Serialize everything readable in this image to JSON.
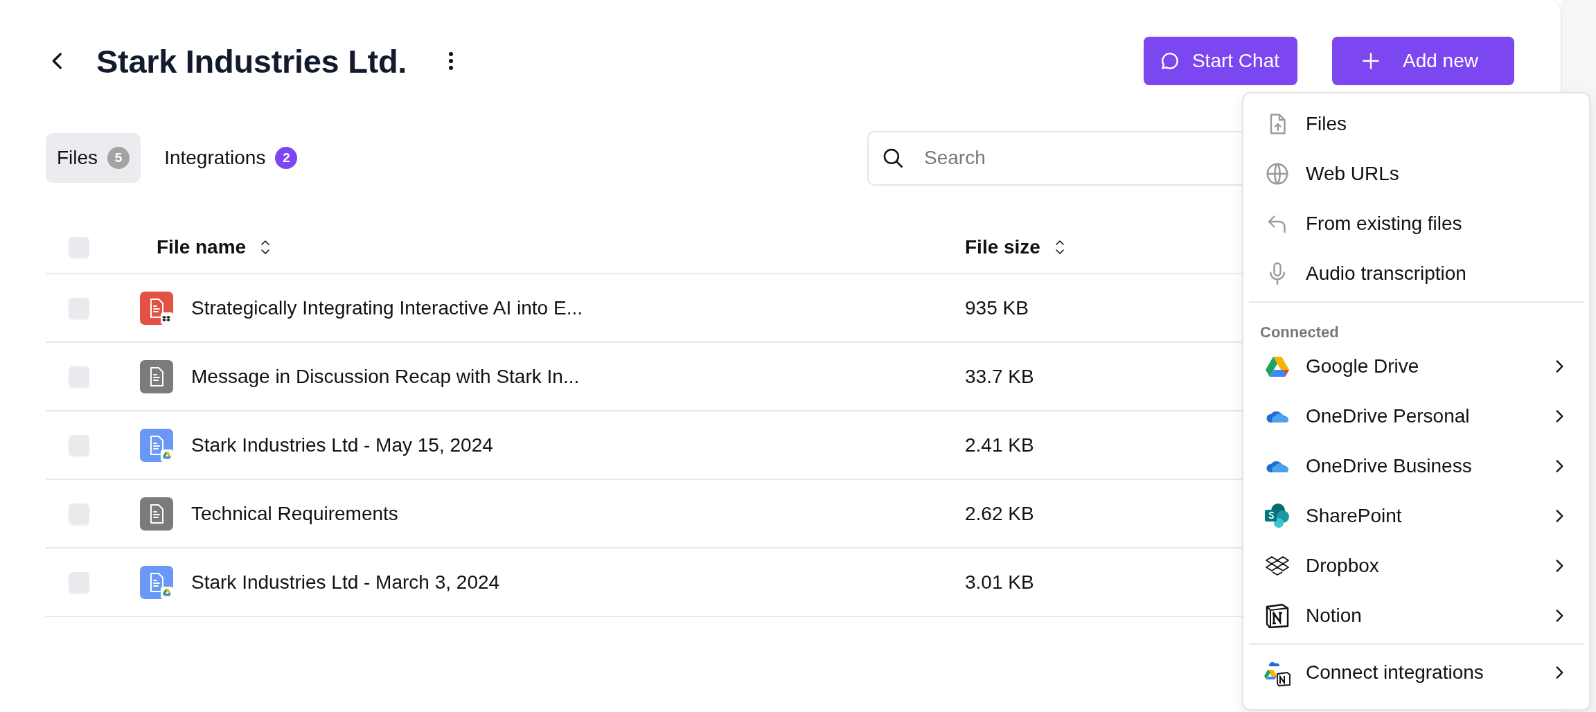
{
  "title": "Stark Industries Ltd.",
  "buttons": [
    {
      "label": "Start Chat"
    },
    {
      "label": "Add new"
    }
  ],
  "tabs": [
    {
      "label": "Files",
      "count": "5",
      "color": "#a3a3a3",
      "selected": true
    },
    {
      "label": "Integrations",
      "count": "2",
      "color": "#7c47f0",
      "selected": false
    }
  ],
  "search": {
    "placeholder": "Search"
  },
  "table": {
    "all_checked": false,
    "columns": [
      {
        "label": "File name"
      },
      {
        "label": "File size"
      }
    ],
    "rows": [
      {
        "name": "Strategically Integrating Interactive AI into E...",
        "size": "935 KB",
        "checked": false
      },
      {
        "name": "Message in Discussion Recap with Stark In...",
        "size": "33.7 KB",
        "checked": false
      },
      {
        "name": "Stark Industries Ltd - May 15, 2024",
        "size": "2.41 KB",
        "checked": false
      },
      {
        "name": "Technical Requirements",
        "size": "2.62 KB",
        "checked": false
      },
      {
        "name": "Stark Industries Ltd - March 3, 2024",
        "size": "3.01 KB",
        "checked": false
      }
    ]
  },
  "menu": {
    "sections": [
      {
        "items": [
          {
            "label": "Files"
          },
          {
            "label": "Web URLs"
          },
          {
            "label": "From existing files"
          },
          {
            "label": "Audio transcription"
          }
        ]
      },
      {
        "heading": "Connected",
        "items": [
          {
            "label": "Google Drive"
          },
          {
            "label": "OneDrive Personal"
          },
          {
            "label": "OneDrive Business"
          },
          {
            "label": "SharePoint"
          },
          {
            "label": "Dropbox"
          },
          {
            "label": "Notion"
          }
        ]
      },
      {
        "items": [
          {
            "label": "Connect integrations"
          }
        ]
      }
    ]
  }
}
